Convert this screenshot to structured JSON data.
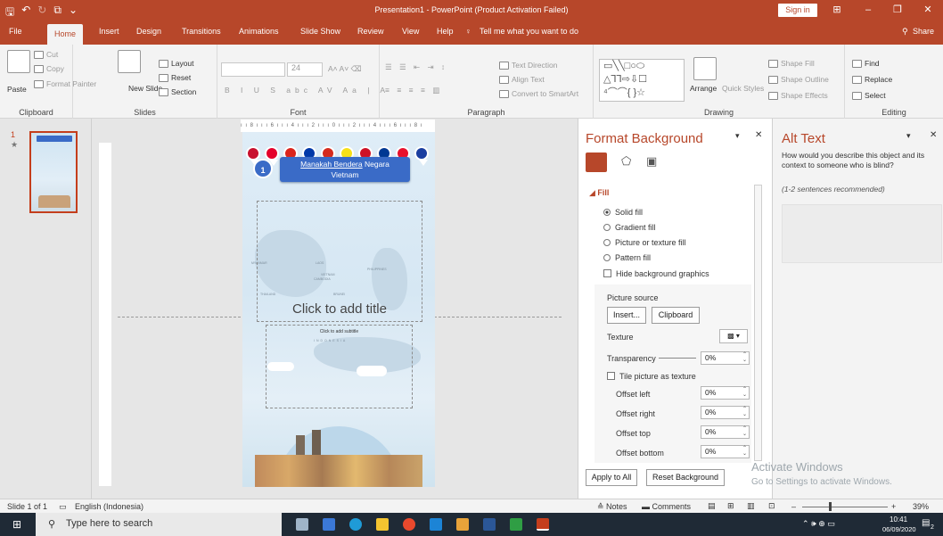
{
  "titlebar": {
    "document_title": "Presentation1  -  PowerPoint (Product Activation Failed)",
    "sign_in": "Sign in",
    "qat_icons": [
      "save-icon",
      "undo-icon",
      "redo-icon",
      "start-slideshow-icon",
      "customize-icon"
    ]
  },
  "tabs": [
    "File",
    "Home",
    "Insert",
    "Design",
    "Transitions",
    "Animations",
    "Slide Show",
    "Review",
    "View",
    "Help"
  ],
  "tell_me": "Tell me what you want to do",
  "share": "Share",
  "ribbon": {
    "clipboard": {
      "label": "Clipboard",
      "paste": "Paste",
      "cut": "Cut",
      "copy": "Copy",
      "format_painter": "Format Painter"
    },
    "slides": {
      "label": "Slides",
      "new_slide": "New Slide",
      "layout": "Layout",
      "reset": "Reset",
      "section": "Section"
    },
    "font": {
      "label": "Font",
      "size": "24"
    },
    "paragraph": {
      "label": "Paragraph",
      "text_direction": "Text Direction",
      "align_text": "Align Text",
      "convert_smartart": "Convert to SmartArt"
    },
    "drawing": {
      "label": "Drawing",
      "arrange": "Arrange",
      "quick_styles": "Quick Styles",
      "shape_fill": "Shape Fill",
      "shape_outline": "Shape Outline",
      "shape_effects": "Shape Effects"
    },
    "editing": {
      "label": "Editing",
      "find": "Find",
      "replace": "Replace",
      "select": "Select"
    }
  },
  "thumbnails": [
    {
      "number": "1",
      "marker": "★"
    }
  ],
  "slide": {
    "badge": "1",
    "banner_line1": "Mana",
    "banner_line1_underlined": "kah Bendera",
    "banner_line1_end": " Negara",
    "banner_line2": "Vietnam",
    "title_placeholder": "Click to add title",
    "subtitle_placeholder": "Click to add subtitle",
    "map_labels": [
      "MYANMAR",
      "LAOS",
      "VIETNAM",
      "PHILIPPINES",
      "CAMBODIA",
      "THAILAND",
      "BRUNEI",
      "INDONESIA"
    ],
    "flag_colors": [
      "#c8102e",
      "#e4002b",
      "#da251d",
      "#0038a8",
      "#d52b1e",
      "#f7e017",
      "#ce1126",
      "#003893",
      "#e8112d",
      "#1a3ea0"
    ]
  },
  "format_background": {
    "title": "Format Background",
    "section": "Fill",
    "options": [
      "Solid fill",
      "Gradient fill",
      "Picture or texture fill",
      "Pattern fill"
    ],
    "selected": "Solid fill",
    "hide_bg": "Hide background graphics",
    "picture_source": "Picture source",
    "insert": "Insert...",
    "clipboard": "Clipboard",
    "texture": "Texture",
    "transparency": "Transparency",
    "transparency_value": "0%",
    "tile": "Tile picture as texture",
    "offsets": [
      {
        "label": "Offset left",
        "value": "0%"
      },
      {
        "label": "Offset right",
        "value": "0%"
      },
      {
        "label": "Offset top",
        "value": "0%"
      },
      {
        "label": "Offset bottom",
        "value": "0%"
      }
    ],
    "apply_to_all": "Apply to All",
    "reset_background": "Reset Background"
  },
  "alt_text": {
    "title": "Alt Text",
    "prompt": "How would you describe this object and its context to someone who is blind?",
    "hint": "(1-2 sentences recommended)"
  },
  "status": {
    "slide": "Slide 1 of 1",
    "language": "English (Indonesia)",
    "notes": "Notes",
    "comments": "Comments",
    "zoom": "39%"
  },
  "watermark": {
    "line1": "Activate Windows",
    "line2": "Go to Settings to activate Windows."
  },
  "taskbar": {
    "search_placeholder": "Type here to search",
    "time": "10:41",
    "date": "06/09/2020",
    "notification_count": "2"
  }
}
